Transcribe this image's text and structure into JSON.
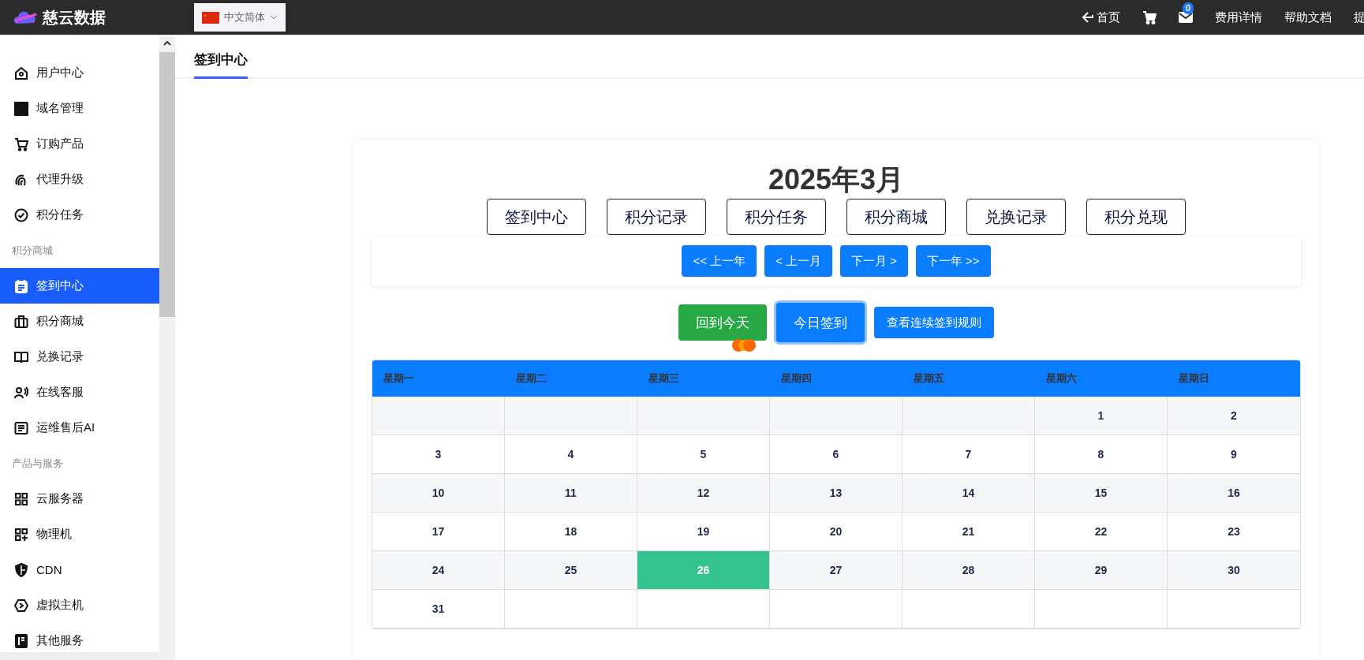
{
  "topbar": {
    "logo_text": "慈云数据",
    "language": "中文简体",
    "links": [
      {
        "kind": "home",
        "text": "首页"
      },
      {
        "kind": "cart"
      },
      {
        "kind": "mail",
        "badge": "0"
      },
      {
        "kind": "text",
        "text": "费用详情"
      },
      {
        "kind": "text",
        "text": "帮助文档"
      },
      {
        "kind": "text",
        "text": "提"
      }
    ]
  },
  "sidebar": {
    "items": [
      {
        "kind": "item",
        "label": "用户中心",
        "selected": false
      },
      {
        "kind": "item",
        "label": "域名管理",
        "selected": false
      },
      {
        "kind": "item",
        "label": "订购产品",
        "selected": false
      },
      {
        "kind": "item",
        "label": "代理升级",
        "selected": false
      },
      {
        "kind": "item",
        "label": "积分任务",
        "selected": false
      },
      {
        "kind": "section",
        "label": "积分商城"
      },
      {
        "kind": "item",
        "label": "签到中心",
        "selected": true
      },
      {
        "kind": "item",
        "label": "积分商城",
        "selected": false
      },
      {
        "kind": "item",
        "label": "兑换记录",
        "selected": false
      },
      {
        "kind": "item",
        "label": "在线客服",
        "selected": false
      },
      {
        "kind": "item",
        "label": "运维售后AI",
        "selected": false
      },
      {
        "kind": "section",
        "label": "产品与服务"
      },
      {
        "kind": "item",
        "label": "云服务器",
        "selected": false
      },
      {
        "kind": "item",
        "label": "物理机",
        "selected": false
      },
      {
        "kind": "item",
        "label": "CDN",
        "selected": false
      },
      {
        "kind": "item",
        "label": "虚拟主机",
        "selected": false
      },
      {
        "kind": "item",
        "label": "其他服务",
        "selected": false
      }
    ]
  },
  "page_tab": {
    "label": "签到中心",
    "selected": true
  },
  "calendar": {
    "title": "2025年3月",
    "nav_buttons": [
      "签到中心",
      "积分记录",
      "积分任务",
      "积分商城",
      "兑换记录",
      "积分兑现"
    ],
    "pager_buttons": [
      "<< 上一年",
      "< 上一月",
      "下一月 >",
      "下一年 >>"
    ],
    "actions": [
      {
        "kind": "success",
        "text": "回到今天"
      },
      {
        "kind": "primary-focus",
        "text": "今日签到"
      },
      {
        "kind": "primary-small",
        "text": "查看连续签到规则"
      }
    ],
    "weekdays": [
      "星期一",
      "星期二",
      "星期三",
      "星期四",
      "星期五",
      "星期六",
      "星期日"
    ],
    "weeks": [
      [
        {
          "kind": "empty"
        },
        {
          "kind": "empty"
        },
        {
          "kind": "empty"
        },
        {
          "kind": "empty"
        },
        {
          "kind": "empty"
        },
        {
          "day": "1",
          "selected": false
        },
        {
          "day": "2",
          "selected": false
        }
      ],
      [
        {
          "day": "3",
          "selected": false
        },
        {
          "day": "4",
          "selected": false
        },
        {
          "day": "5",
          "selected": false
        },
        {
          "day": "6",
          "selected": false
        },
        {
          "day": "7",
          "selected": false
        },
        {
          "day": "8",
          "selected": false
        },
        {
          "day": "9",
          "selected": false
        }
      ],
      [
        {
          "day": "10",
          "selected": false
        },
        {
          "day": "11",
          "selected": false
        },
        {
          "day": "12",
          "selected": false
        },
        {
          "day": "13",
          "selected": false
        },
        {
          "day": "14",
          "selected": false
        },
        {
          "day": "15",
          "selected": false
        },
        {
          "day": "16",
          "selected": false
        }
      ],
      [
        {
          "day": "17",
          "selected": false
        },
        {
          "day": "18",
          "selected": false
        },
        {
          "day": "19",
          "selected": false
        },
        {
          "day": "20",
          "selected": false
        },
        {
          "day": "21",
          "selected": false
        },
        {
          "day": "22",
          "selected": false
        },
        {
          "day": "23",
          "selected": false
        }
      ],
      [
        {
          "day": "24",
          "selected": false
        },
        {
          "day": "25",
          "selected": false
        },
        {
          "day": "26",
          "selected": true
        },
        {
          "day": "27",
          "selected": false
        },
        {
          "day": "28",
          "selected": false
        },
        {
          "day": "29",
          "selected": false
        },
        {
          "day": "30",
          "selected": false
        }
      ],
      [
        {
          "day": "31",
          "selected": false
        },
        {
          "kind": "empty"
        },
        {
          "kind": "empty"
        },
        {
          "kind": "empty"
        },
        {
          "kind": "empty"
        },
        {
          "kind": "empty"
        },
        {
          "kind": "empty"
        }
      ]
    ]
  }
}
